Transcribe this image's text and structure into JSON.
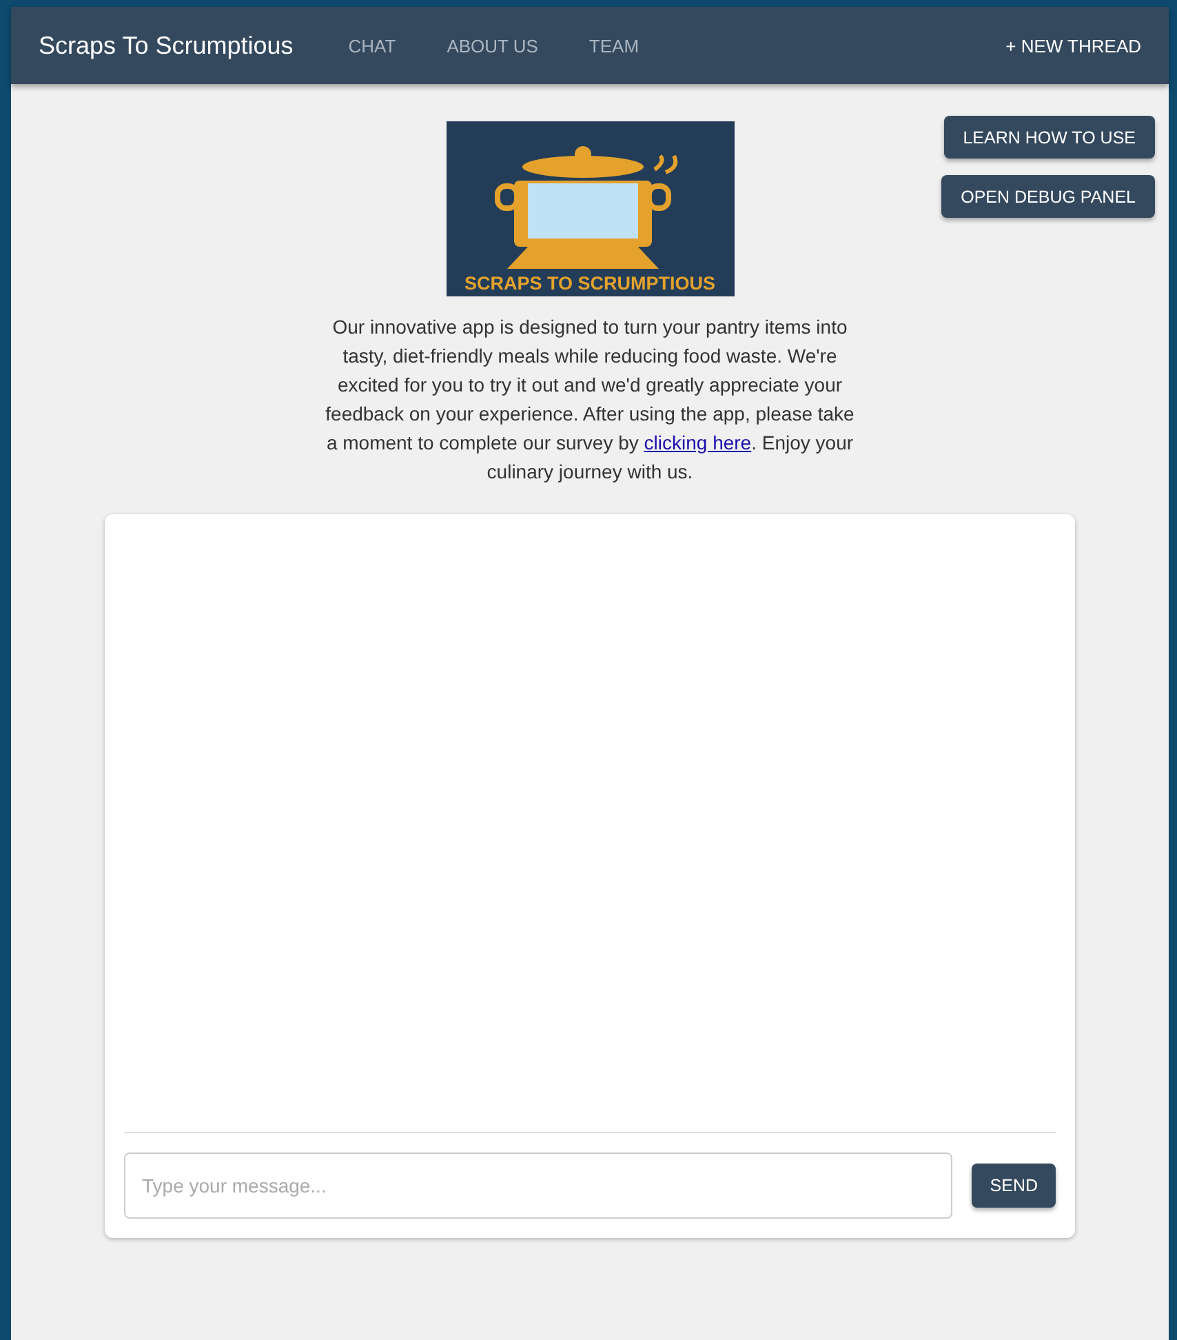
{
  "navbar": {
    "brand": "Scraps To Scrumptious",
    "links": [
      "CHAT",
      "ABOUT US",
      "TEAM"
    ],
    "new_thread": "+ NEW THREAD"
  },
  "logo": {
    "caption": "SCRAPS TO SCRUMPTIOUS"
  },
  "side_buttons": [
    "LEARN HOW TO USE",
    "OPEN DEBUG PANEL"
  ],
  "intro": {
    "before": "Our innovative app is designed to turn your pantry items into tasty, diet-friendly meals while reducing food waste. We're excited for you to try it out and we'd greatly appreciate your feedback on your experience. After using the app, please take a moment to complete our survey by ",
    "link": "clicking here",
    "after": ". Enjoy your culinary journey with us."
  },
  "chat": {
    "placeholder": "Type your message...",
    "send": "SEND"
  }
}
